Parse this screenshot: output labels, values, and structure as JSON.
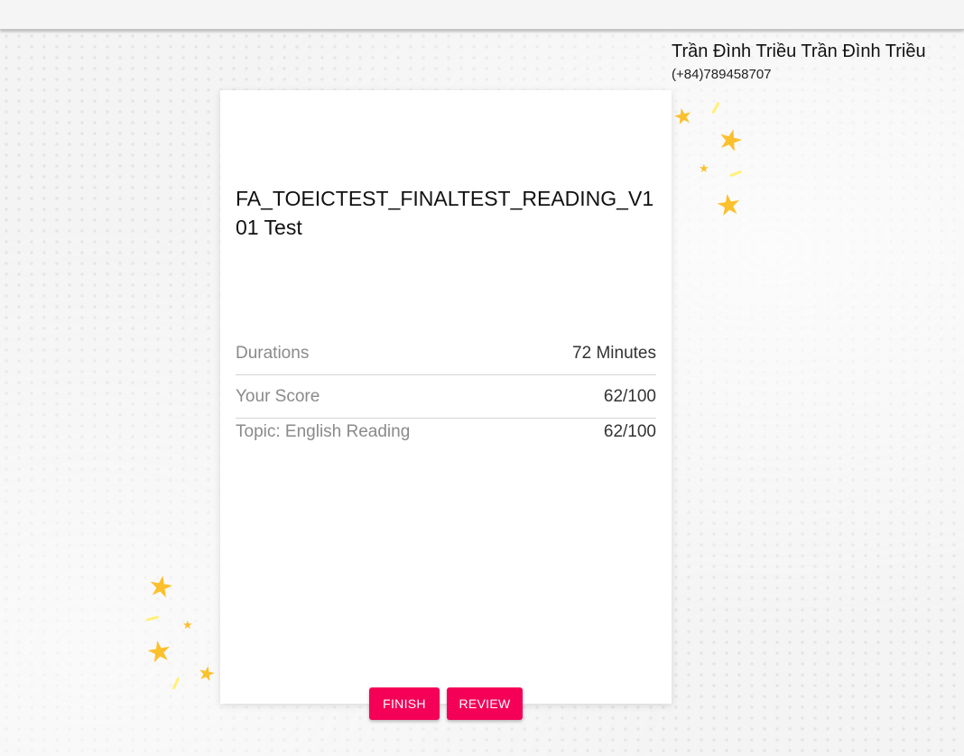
{
  "user": {
    "name": "Trần Đình Triều Trần Đình Triều",
    "phone": "(+84)789458707"
  },
  "test": {
    "title": "FA_TOEICTEST_FINALTEST_READING_V101 Test",
    "rows": [
      {
        "label": "Durations",
        "value": "72 Minutes"
      },
      {
        "label": "Your Score",
        "value": "62/100"
      },
      {
        "label": "Topic: English Reading",
        "value": "62/100"
      }
    ]
  },
  "actions": {
    "finish_label": "FINISH",
    "review_label": "REVIEW"
  },
  "colors": {
    "accent": "#f50057",
    "star": "#fbc02d"
  },
  "icons": {
    "decoration": "star-icon"
  }
}
